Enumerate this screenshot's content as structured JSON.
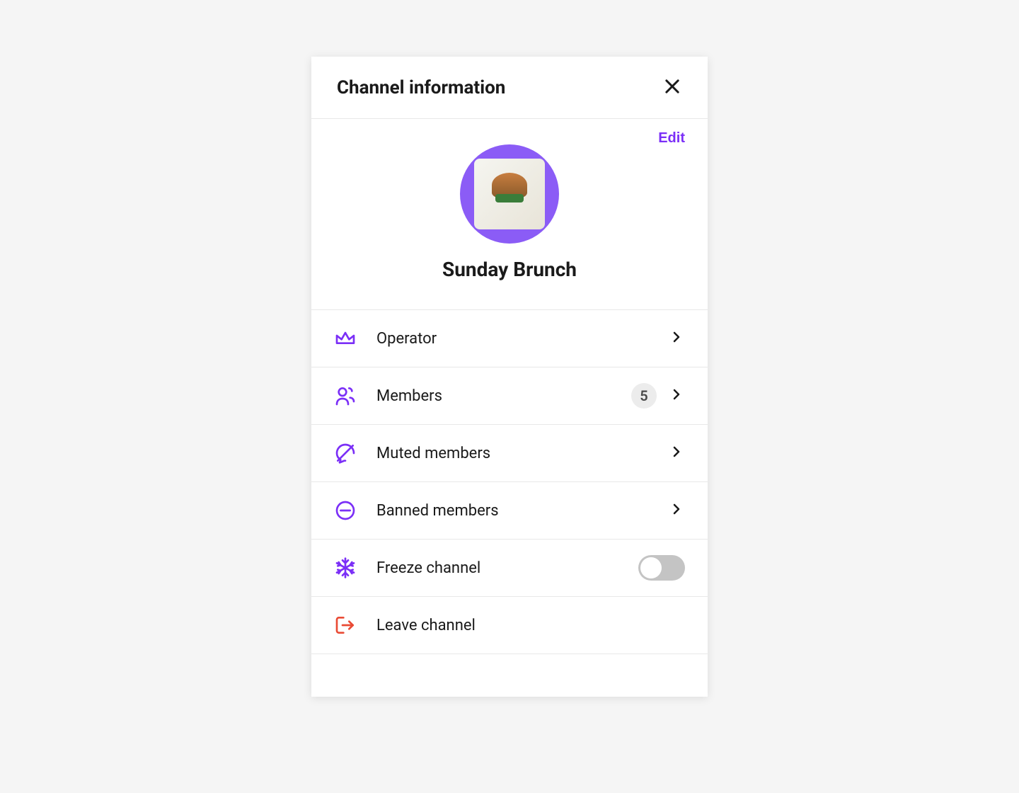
{
  "header": {
    "title": "Channel information"
  },
  "profile": {
    "edit_label": "Edit",
    "channel_name": "Sunday Brunch"
  },
  "items": {
    "operator": {
      "label": "Operator"
    },
    "members": {
      "label": "Members",
      "count": "5"
    },
    "muted": {
      "label": "Muted members"
    },
    "banned": {
      "label": "Banned members"
    },
    "freeze": {
      "label": "Freeze channel",
      "toggled": false
    },
    "leave": {
      "label": "Leave channel"
    }
  },
  "colors": {
    "accent": "#7b2ff7",
    "danger": "#e94b35"
  }
}
